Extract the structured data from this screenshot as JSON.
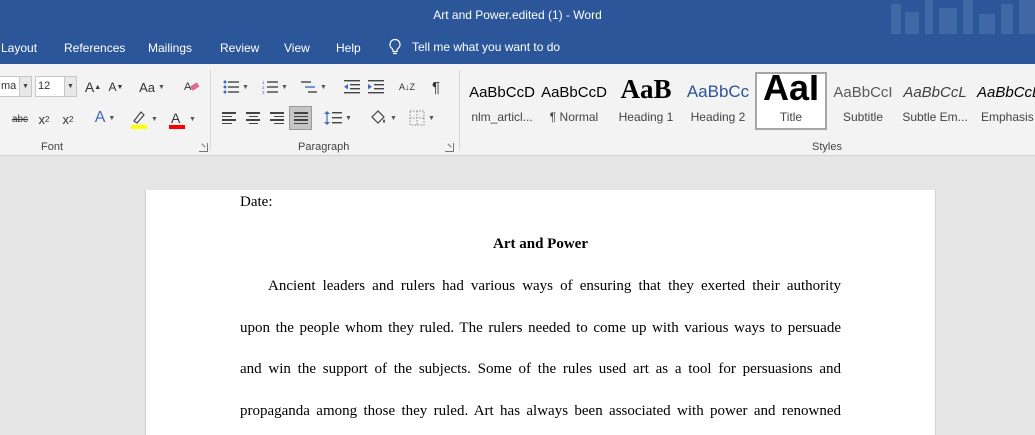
{
  "window": {
    "title": "Art and Power.edited (1)  -  Word"
  },
  "menu": {
    "tabs": [
      {
        "label": "Layout"
      },
      {
        "label": "References"
      },
      {
        "label": "Mailings"
      },
      {
        "label": "Review"
      },
      {
        "label": "View"
      },
      {
        "label": "Help"
      }
    ],
    "tell_me": "Tell me what you want to do"
  },
  "font_group": {
    "font_name": "ma",
    "font_size": "12",
    "label": "Font",
    "grow_label": "A",
    "shrink_label": "A",
    "case_label": "Aa",
    "strike_label": "abc",
    "sub_label": "x",
    "sub_mark": "2",
    "sup_label": "x",
    "sup_mark": "2",
    "effects_label": "A",
    "font_color_label": "A",
    "highlight_color": "#ffff00",
    "font_color": "#ff0000"
  },
  "paragraph_group": {
    "label": "Paragraph",
    "sort_label": "A↓Z",
    "pilcrow": "¶"
  },
  "styles_group": {
    "label": "Styles",
    "items": [
      {
        "preview": "AaBbCcD",
        "name": "nlm_articl..."
      },
      {
        "preview": "AaBbCcD",
        "name": "¶ Normal"
      },
      {
        "preview": "AaB",
        "name": "Heading 1"
      },
      {
        "preview": "AaBbCc",
        "name": "Heading 2"
      },
      {
        "preview": "AaI",
        "name": "Title"
      },
      {
        "preview": "AaBbCcI",
        "name": "Subtitle"
      },
      {
        "preview": "AaBbCcL",
        "name": "Subtle Em..."
      },
      {
        "preview": "AaBbCcL",
        "name": "Emphasis"
      }
    ],
    "selected": "Title"
  },
  "document": {
    "date_line": "Date:",
    "heading": "Art and Power",
    "lines": [
      "Ancient leaders and rulers had various ways of ensuring that they exerted their authority",
      "upon the people whom they ruled. The rulers needed to come up with various ways to persuade",
      "and win the support of the subjects. Some of the rules used art as a tool for persuasions and",
      "propaganda among those they ruled. Art has always been associated with power and renowned"
    ]
  },
  "colors": {
    "titlebar": "#2b579a",
    "ribbon": "#f3f3f3",
    "canvas": "#e6e6e6"
  }
}
